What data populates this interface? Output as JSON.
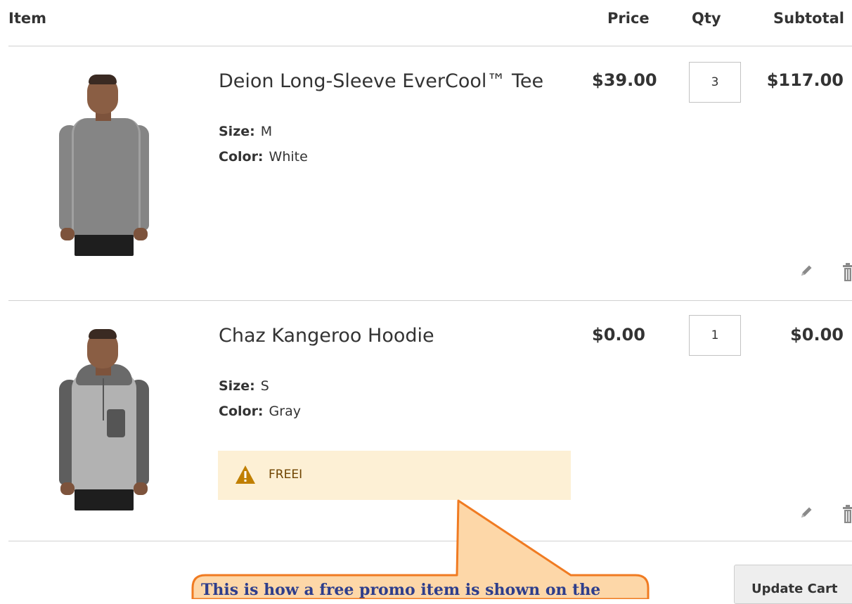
{
  "header": {
    "item": "Item",
    "price": "Price",
    "qty": "Qty",
    "subtotal": "Subtotal"
  },
  "items": [
    {
      "name": "Deion Long-Sleeve EverCool™ Tee",
      "size_label": "Size:",
      "size": "M",
      "color_label": "Color:",
      "color": "White",
      "price": "$39.00",
      "qty": "3",
      "subtotal": "$117.00"
    },
    {
      "name": "Chaz Kangeroo Hoodie",
      "size_label": "Size:",
      "size": "S",
      "color_label": "Color:",
      "color": "Gray",
      "price": "$0.00",
      "qty": "1",
      "subtotal": "$0.00",
      "message": "FREEI"
    }
  ],
  "actions": {
    "update_cart": "Update Cart"
  },
  "callout": {
    "text": "This is how a free promo item is shown on the"
  },
  "colors": {
    "message_bg": "#fdf0d5",
    "warning_icon": "#c07f00",
    "callout_fill": "#fdd7a8",
    "callout_border": "#f07b22",
    "callout_text": "#2e3e8c"
  },
  "icons": [
    "pencil-icon",
    "trash-icon",
    "warning-icon"
  ]
}
